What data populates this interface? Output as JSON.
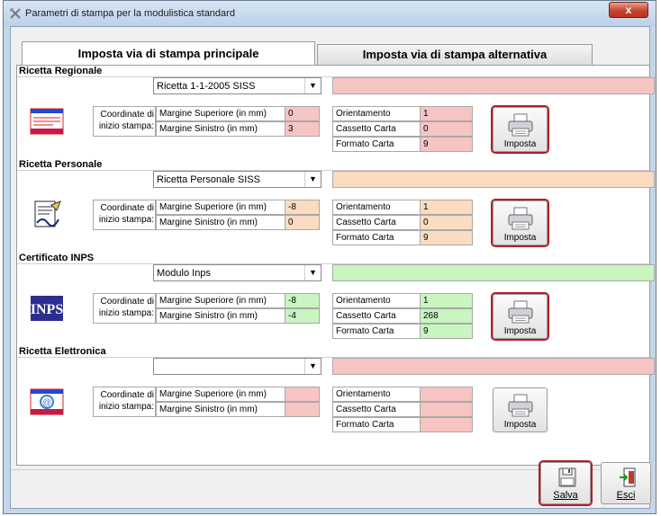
{
  "window": {
    "title": "Parametri di stampa per la modulistica standard",
    "close_label": "x"
  },
  "tabs": [
    {
      "label": "Imposta via di stampa principale",
      "active": true
    },
    {
      "label": "Imposta via di stampa alternativa",
      "active": false
    }
  ],
  "common": {
    "coord_label_line1": "Coordinate di",
    "coord_label_line2": "inizio stampa:",
    "margin_top_label": "Margine Superiore (in mm)",
    "margin_left_label": "Margine Sinistro (in mm)",
    "orientation_label": "Orientamento",
    "tray_label": "Cassetto Carta",
    "paper_format_label": "Formato Carta",
    "imposta_label": "Imposta"
  },
  "sections": [
    {
      "title": "Ricetta Regionale",
      "combo_value": "Ricetta 1-1-2005 SISS",
      "margin_top": "0",
      "margin_left": "3",
      "orientamento": "1",
      "cassetto": "0",
      "formato": "9",
      "color": "#f7c4c4",
      "icon": "ricetta-regionale-icon",
      "highlighted": true
    },
    {
      "title": "Ricetta Personale",
      "combo_value": "Ricetta Personale SISS",
      "margin_top": "-8",
      "margin_left": "0",
      "orientamento": "1",
      "cassetto": "0",
      "formato": "9",
      "color": "#fbdcc0",
      "icon": "signature-document-icon",
      "highlighted": true
    },
    {
      "title": "Certificato INPS",
      "combo_value": "Modulo Inps",
      "margin_top": "-8",
      "margin_left": "-4",
      "orientamento": "1",
      "cassetto": "268",
      "formato": "9",
      "color": "#c8f5c0",
      "icon": "inps-logo-icon",
      "highlighted": true
    },
    {
      "title": "Ricetta Elettronica",
      "combo_value": "",
      "margin_top": "",
      "margin_left": "",
      "orientamento": "",
      "cassetto": "",
      "formato": "",
      "color": "#f7c4c4",
      "icon": "ricetta-elettronica-icon",
      "highlighted": false
    }
  ],
  "footer": {
    "save_label": "Salva",
    "exit_label": "Esci"
  },
  "colors": {
    "highlight_border": "#b01f2a",
    "titlebar": "#c5d6e8"
  }
}
